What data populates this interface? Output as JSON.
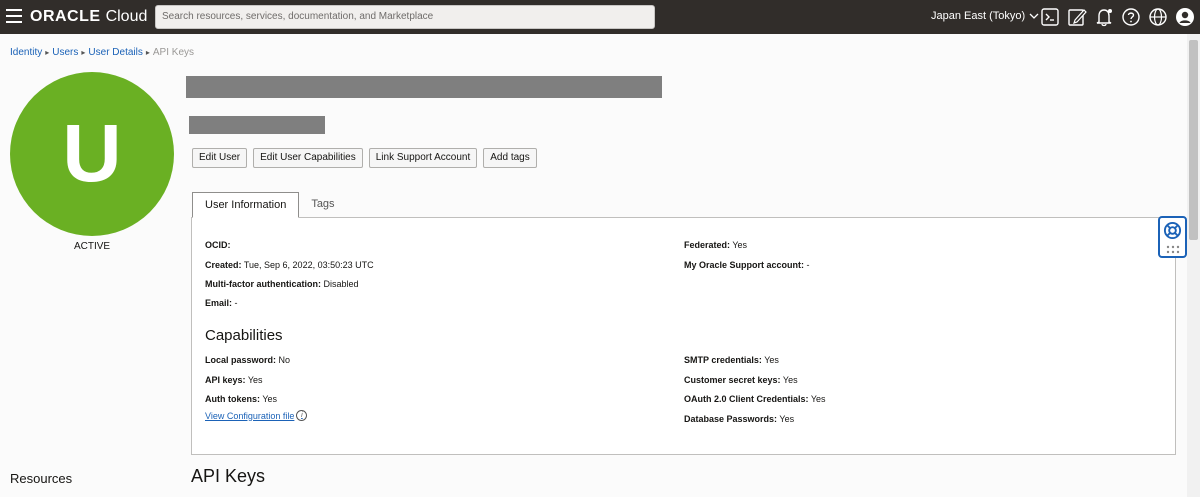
{
  "topbar": {
    "logo_oracle": "ORACLE",
    "logo_cloud": "Cloud",
    "search_placeholder": "Search resources, services, documentation, and Marketplace",
    "region": "Japan East (Tokyo)",
    "icons": [
      "cloud-shell-icon",
      "edit-icon",
      "notifications-icon",
      "help-icon",
      "language-icon",
      "profile-icon"
    ]
  },
  "breadcrumb": {
    "items": [
      "Identity",
      "Users",
      "User Details"
    ],
    "current": "API Keys"
  },
  "user": {
    "avatar_letter": "U",
    "status": "ACTIVE",
    "avatar_color": "#6ab023"
  },
  "actions": [
    "Edit User",
    "Edit User Capabilities",
    "Link Support Account",
    "Add tags"
  ],
  "tabs": [
    "User Information",
    "Tags"
  ],
  "info": {
    "ocid_label": "OCID:",
    "ocid_value": "",
    "created_label": "Created:",
    "created_value": "Tue, Sep 6, 2022, 03:50:23 UTC",
    "mfa_label": "Multi-factor authentication:",
    "mfa_value": "Disabled",
    "email_label": "Email:",
    "email_value": "-",
    "federated_label": "Federated:",
    "federated_value": "Yes",
    "support_label": "My Oracle Support account:",
    "support_value": "-"
  },
  "capabilities": {
    "title": "Capabilities",
    "local_password_label": "Local password:",
    "local_password_value": "No",
    "api_keys_label": "API keys:",
    "api_keys_value": "Yes",
    "auth_tokens_label": "Auth tokens:",
    "auth_tokens_value": "Yes",
    "smtp_label": "SMTP credentials:",
    "smtp_value": "Yes",
    "customer_secret_label": "Customer secret keys:",
    "customer_secret_value": "Yes",
    "oauth_label": "OAuth 2.0 Client Credentials:",
    "oauth_value": "Yes",
    "db_passwords_label": "Database Passwords:",
    "db_passwords_value": "Yes",
    "config_link": "View Configuration file",
    "info_glyph": "i"
  },
  "footer": {
    "resources": "Resources",
    "api_keys_heading": "API Keys"
  }
}
